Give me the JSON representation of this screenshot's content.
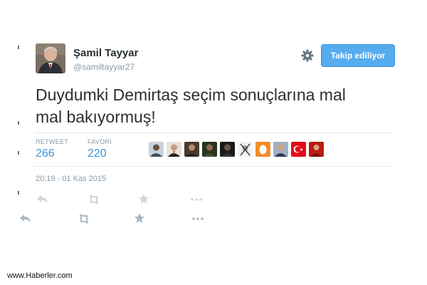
{
  "tweet": {
    "display_name": "Şamil Tayyar",
    "screen_name": "@samiltayyar27",
    "follow_button_label": "Takip ediliyor",
    "text": "Duydumki Demirtaş seçim sonuçlarına mal\nmal bakıyormuş!",
    "stats": {
      "retweet_label": "RETWEET",
      "retweet_count": "266",
      "favorite_label": "FAVORİ",
      "favorite_count": "220"
    },
    "timestamp": "20:19 - 01 Kas 2015"
  },
  "icons": {
    "settings": "gear-icon",
    "reply": "reply-icon",
    "retweet": "retweet-icon",
    "favorite": "star-icon",
    "more": "more-dots-icon"
  },
  "colors": {
    "accent": "#55acee",
    "link": "#3b94d9",
    "muted": "#8899a6",
    "text": "#292f33"
  },
  "watermark": "www.Haberler.com"
}
